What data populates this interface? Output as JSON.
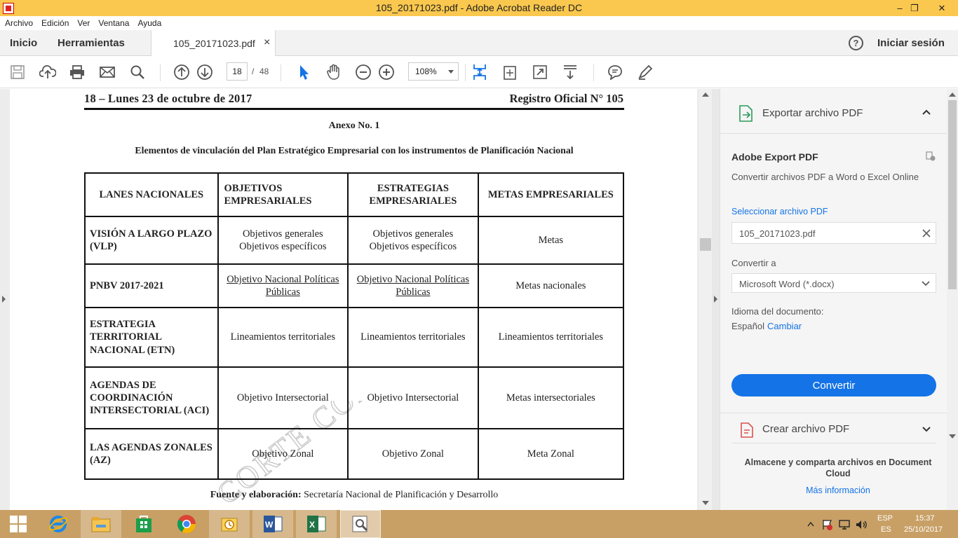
{
  "window": {
    "title": "105_20171023.pdf - Adobe Acrobat Reader DC",
    "minimize": "–",
    "maximize": "❐",
    "close": "✕"
  },
  "menu": [
    "Archivo",
    "Edición",
    "Ver",
    "Ventana",
    "Ayuda"
  ],
  "tabs": {
    "home": "Inicio",
    "tools": "Herramientas",
    "document": "105_20171023.pdf",
    "close": "×",
    "help": "?",
    "signin": "Iniciar sesión"
  },
  "toolbar": {
    "page_current": "18",
    "page_sep": "/",
    "page_total": "48",
    "zoom": "108%"
  },
  "document": {
    "header_left": "18  –  Lunes  23 de octubre de 2017",
    "header_right": "Registro Oficial N° 105",
    "annex_title": "Anexo No. 1",
    "subtitle": "Elementos de vinculación del Plan Estratégico Empresarial con los instrumentos de Planificación Nacional",
    "columns": [
      "LANES NACIONALES",
      "OBJETIVOS EMPRESARIALES",
      "ESTRATEGIAS EMPRESARIALES",
      "METAS EMPRESARIALES"
    ],
    "rows": [
      {
        "lane": "VISIÓN A LARGO PLAZO (VLP)",
        "objectives": "Objetivos generales Objetivos específicos",
        "strategies": "Objetivos generales Objetivos específicos",
        "goals": "Metas"
      },
      {
        "lane": "PNBV 2017-2021",
        "objectives": "Objetivo Nacional Políticas Públicas",
        "strategies": "Objetivo Nacional Políticas Públicas",
        "goals": "Metas nacionales"
      },
      {
        "lane": "ESTRATEGIA TERRITORIAL NACIONAL (ETN)",
        "objectives": "Lineamientos territoriales",
        "strategies": "Lineamientos territoriales",
        "goals": "Lineamientos territoriales"
      },
      {
        "lane": "AGENDAS DE COORDINACIÓN INTERSECTORIAL (ACI)",
        "objectives": "Objetivo Intersectorial",
        "strategies": "Objetivo Intersectorial",
        "goals": "Metas intersectoriales"
      },
      {
        "lane": "LAS AGENDAS ZONALES (AZ)",
        "objectives": "Objetivo Zonal",
        "strategies": "Objetivo Zonal",
        "goals": "Meta Zonal"
      }
    ],
    "source_label": "Fuente y elaboración:",
    "source_text": "Secretaría Nacional de Planificación y Desarrollo",
    "watermark": "CORTE CONSTITUCIONAL DEL ECUADOR"
  },
  "side_panel": {
    "export_title": "Exportar archivo PDF",
    "product": "Adobe Export PDF",
    "description": "Convertir archivos PDF a Word o Excel Online",
    "select_label": "Seleccionar archivo PDF",
    "file_name": "105_20171023.pdf",
    "convert_to_label": "Convertir a",
    "format": "Microsoft Word (*.docx)",
    "language_label": "Idioma del documento:",
    "language": "Español",
    "change": "Cambiar",
    "convert_button": "Convertir",
    "create_title": "Crear archivo PDF",
    "cloud_text": "Almacene y comparta archivos en Document Cloud",
    "more_info": "Más información"
  },
  "taskbar": {
    "lang_top": "ESP",
    "lang_bottom": "ES",
    "time": "15:37",
    "date": "25/10/2017"
  },
  "colors": {
    "titlebar": "#fac84e",
    "accent": "#1473e6",
    "taskbar": "#c8a066"
  }
}
